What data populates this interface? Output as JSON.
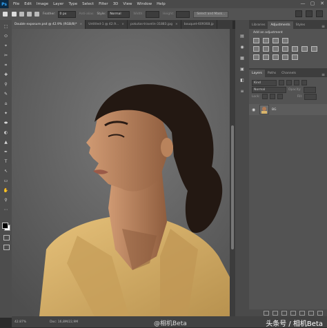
{
  "app": {
    "logo": "Ps"
  },
  "menu": [
    "File",
    "Edit",
    "Image",
    "Layer",
    "Type",
    "Select",
    "Filter",
    "3D",
    "View",
    "Window",
    "Help"
  ],
  "window_controls": [
    "—",
    "▢",
    "✕"
  ],
  "options": {
    "feather_label": "Feather:",
    "feather_value": "0 px",
    "antialias_label": "Anti-alias",
    "style_label": "Style:",
    "style_value": "Normal",
    "width_label": "Width:",
    "height_label": "Height:",
    "select_mask_label": "Select and Mask..."
  },
  "doc_tabs": [
    {
      "label": "Double exposure.psd @ 42.9% (RGB/8)*",
      "active": true
    },
    {
      "label": "Untitled-1 @ 42.9...",
      "active": false
    },
    {
      "label": "pokutas-travelin-31883.jpg",
      "active": false
    },
    {
      "label": "bouquet-609368.jp",
      "active": false
    }
  ],
  "tools": [
    "⬚",
    "⬭",
    "⌖",
    "✂",
    "⌗",
    "✚",
    "⚲",
    "✎",
    "⌂",
    "✦",
    "⬬",
    "◐",
    "▲",
    "✒",
    "T",
    "↖",
    "▭",
    "✋",
    "⚲",
    "⋯"
  ],
  "right_strip_icons": [
    "▤",
    "◉",
    "▦",
    "▣",
    "◧",
    "≡"
  ],
  "panels": {
    "top_tabs": [
      "Libraries",
      "Adjustments",
      "Styles"
    ],
    "adj_title": "Add an adjustment",
    "layers_tabs": [
      "Layers",
      "Paths",
      "Channels"
    ],
    "kind_label": "Kind",
    "blend_mode": "Normal",
    "opacity_label": "Opacity:",
    "fill_label": "Fill:",
    "lock_label": "Lock:",
    "layer_name": "BG"
  },
  "status": {
    "zoom": "42.87%",
    "doc": "Doc: 16,8M/22,9M",
    "watermark_left": "@相机Beta",
    "watermark_right": "头条号 / 相机Beta"
  },
  "colors": {
    "canvas_bg": "#6a6a6a",
    "shirt": "#d9b56b",
    "skin": "#b07a55",
    "hair": "#231812"
  }
}
